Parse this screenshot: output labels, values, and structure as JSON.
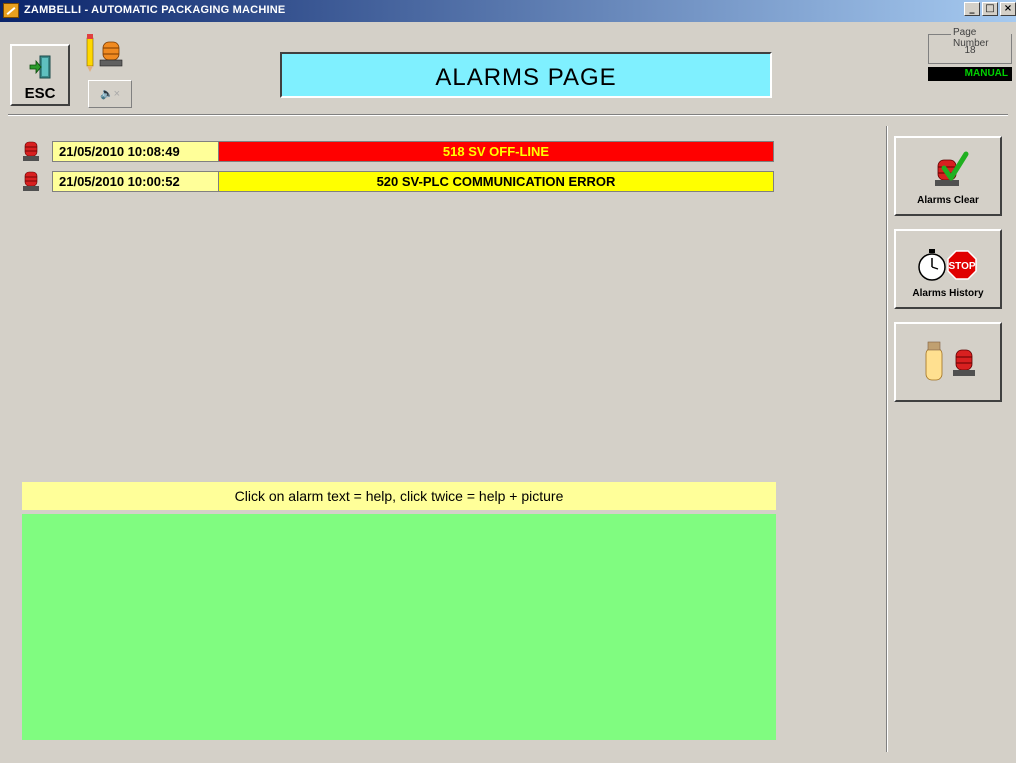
{
  "window": {
    "title": "ZAMBELLI - AUTOMATIC PACKAGING MACHINE",
    "controls": [
      "_",
      "□",
      "×"
    ]
  },
  "header": {
    "esc_label": "ESC",
    "page_title": "ALARMS PAGE",
    "page_number_label": "Page Number",
    "page_number": "18",
    "mode": "MANUAL",
    "mute_icon": "speaker-mute-icon"
  },
  "alarms": [
    {
      "timestamp": "21/05/2010 10:08:49",
      "text": "518 SV OFF-LINE",
      "bg_color": "#ff0000",
      "text_color": "#ffff00",
      "icon": "red-beacon-icon"
    },
    {
      "timestamp": "21/05/2010 10:00:52",
      "text": "520 SV-PLC COMMUNICATION ERROR",
      "bg_color": "#ffff00",
      "text_color": "#000000",
      "icon": "red-beacon-icon"
    }
  ],
  "help": {
    "instructions": "Click on alarm text = help, click twice = help + picture"
  },
  "sidebar": {
    "buttons": [
      {
        "label": "Alarms Clear",
        "icon": "beacon-check-icon"
      },
      {
        "label": "Alarms History",
        "icon": "stopwatch-stop-icon"
      },
      {
        "label": "",
        "icon": "operator-beacon-icon"
      }
    ],
    "stop_sign_text": "STOP"
  }
}
